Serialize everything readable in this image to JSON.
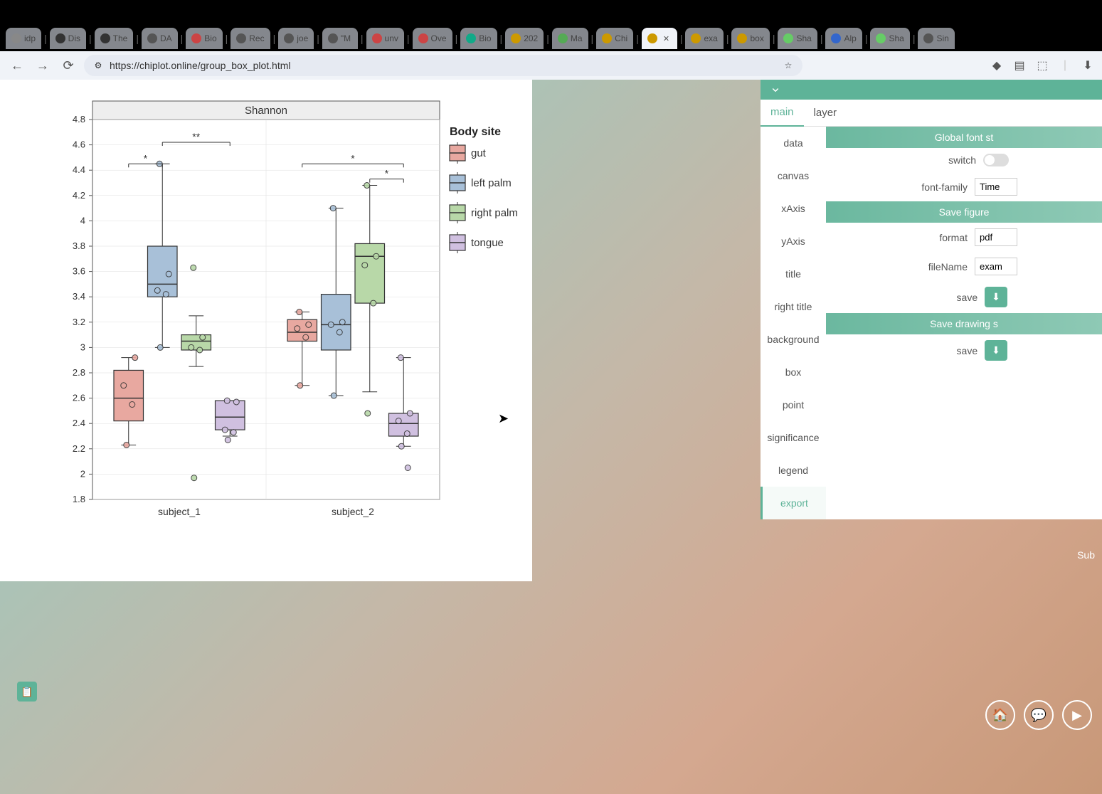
{
  "browser": {
    "url": "https://chiplot.online/group_box_plot.html",
    "tabs": [
      {
        "label": "idp",
        "color": "#888"
      },
      {
        "label": "Dis",
        "color": "#333"
      },
      {
        "label": "The",
        "color": "#333"
      },
      {
        "label": "DA",
        "color": "#555"
      },
      {
        "label": "Bio",
        "color": "#c44"
      },
      {
        "label": "Rec",
        "color": "#555"
      },
      {
        "label": "joe",
        "color": "#555"
      },
      {
        "label": "\"M",
        "color": "#555"
      },
      {
        "label": "unv",
        "color": "#c44"
      },
      {
        "label": "Ove",
        "color": "#c44"
      },
      {
        "label": "Bio",
        "color": "#1a8"
      },
      {
        "label": "202",
        "color": "#c90"
      },
      {
        "label": "Ma",
        "color": "#5a5"
      },
      {
        "label": "Chi",
        "color": "#c90"
      },
      {
        "label": "",
        "color": "#c90",
        "active": true
      },
      {
        "label": "exa",
        "color": "#c90"
      },
      {
        "label": "box",
        "color": "#c90"
      },
      {
        "label": "Sha",
        "color": "#6c6"
      },
      {
        "label": "Alp",
        "color": "#36c"
      },
      {
        "label": "Sha",
        "color": "#6c6"
      },
      {
        "label": "Sin",
        "color": "#555"
      }
    ]
  },
  "settings": {
    "tabs": {
      "main": "main",
      "layer": "layer"
    },
    "menu": [
      "data",
      "canvas",
      "xAxis",
      "yAxis",
      "title",
      "right title",
      "background",
      "box",
      "point",
      "significance",
      "legend",
      "export"
    ],
    "menu_active": "export",
    "sec1": "Global font st",
    "switch_label": "switch",
    "font_label": "font-family",
    "font_value": "Time",
    "sec2": "Save figure",
    "format_label": "format",
    "format_value": "pdf",
    "filename_label": "fileName",
    "filename_value": "exam",
    "save_label": "save",
    "sec3": "Save drawing s",
    "save2_label": "save"
  },
  "footer": "Sub",
  "chart_data": {
    "type": "grouped_boxplot",
    "title": "Shannon",
    "legend_title": "Body site",
    "x_categories": [
      "subject_1",
      "subject_2"
    ],
    "ylim": [
      1.8,
      4.8
    ],
    "yticks": [
      1.8,
      2,
      2.2,
      2.4,
      2.6,
      2.8,
      3,
      3.2,
      3.4,
      3.6,
      3.8,
      4,
      4.2,
      4.4,
      4.6,
      4.8
    ],
    "groups": [
      {
        "name": "gut",
        "color": "#e8a8a0"
      },
      {
        "name": "left palm",
        "color": "#a8c0d8"
      },
      {
        "name": "right palm",
        "color": "#b8d8a8"
      },
      {
        "name": "tongue",
        "color": "#d0c0e0"
      }
    ],
    "boxes": {
      "subject_1": {
        "gut": {
          "min": 2.23,
          "q1": 2.42,
          "median": 2.6,
          "q3": 2.82,
          "max": 2.92,
          "points": [
            2.23,
            2.55,
            2.7,
            2.92
          ]
        },
        "left palm": {
          "min": 3.0,
          "q1": 3.4,
          "median": 3.5,
          "q3": 3.8,
          "max": 4.45,
          "points": [
            3.0,
            3.42,
            3.45,
            3.58,
            4.45
          ]
        },
        "right palm": {
          "min": 2.85,
          "q1": 2.98,
          "median": 3.05,
          "q3": 3.1,
          "max": 3.25,
          "points": [
            1.97,
            2.98,
            3.0,
            3.08,
            3.63
          ]
        },
        "tongue": {
          "min": 2.3,
          "q1": 2.35,
          "median": 2.45,
          "q3": 2.58,
          "max": 2.58,
          "points": [
            2.27,
            2.33,
            2.35,
            2.57,
            2.58
          ]
        }
      },
      "subject_2": {
        "gut": {
          "min": 2.7,
          "q1": 3.05,
          "median": 3.12,
          "q3": 3.22,
          "max": 3.28,
          "points": [
            2.7,
            3.08,
            3.15,
            3.18,
            3.28
          ]
        },
        "left palm": {
          "min": 2.62,
          "q1": 2.98,
          "median": 3.18,
          "q3": 3.42,
          "max": 4.1,
          "points": [
            2.62,
            3.12,
            3.18,
            3.2,
            4.1
          ]
        },
        "right palm": {
          "min": 2.65,
          "q1": 3.35,
          "median": 3.72,
          "q3": 3.82,
          "max": 4.28,
          "points": [
            2.48,
            3.35,
            3.65,
            3.72,
            4.28
          ]
        },
        "tongue": {
          "min": 2.22,
          "q1": 2.3,
          "median": 2.4,
          "q3": 2.48,
          "max": 2.92,
          "points": [
            2.22,
            2.32,
            2.42,
            2.48,
            2.92,
            2.05
          ]
        }
      }
    },
    "significance": [
      {
        "subject": "subject_1",
        "g1": "gut",
        "g2": "left palm",
        "y": 4.45,
        "label": "*"
      },
      {
        "subject": "subject_1",
        "g1": "left palm",
        "g2": "tongue",
        "y": 4.62,
        "label": "**"
      },
      {
        "subject": "subject_2",
        "g1": "gut",
        "g2": "tongue",
        "y": 4.45,
        "label": "*"
      },
      {
        "subject": "subject_2",
        "g1": "right palm",
        "g2": "tongue",
        "y": 4.33,
        "label": "*"
      }
    ]
  }
}
